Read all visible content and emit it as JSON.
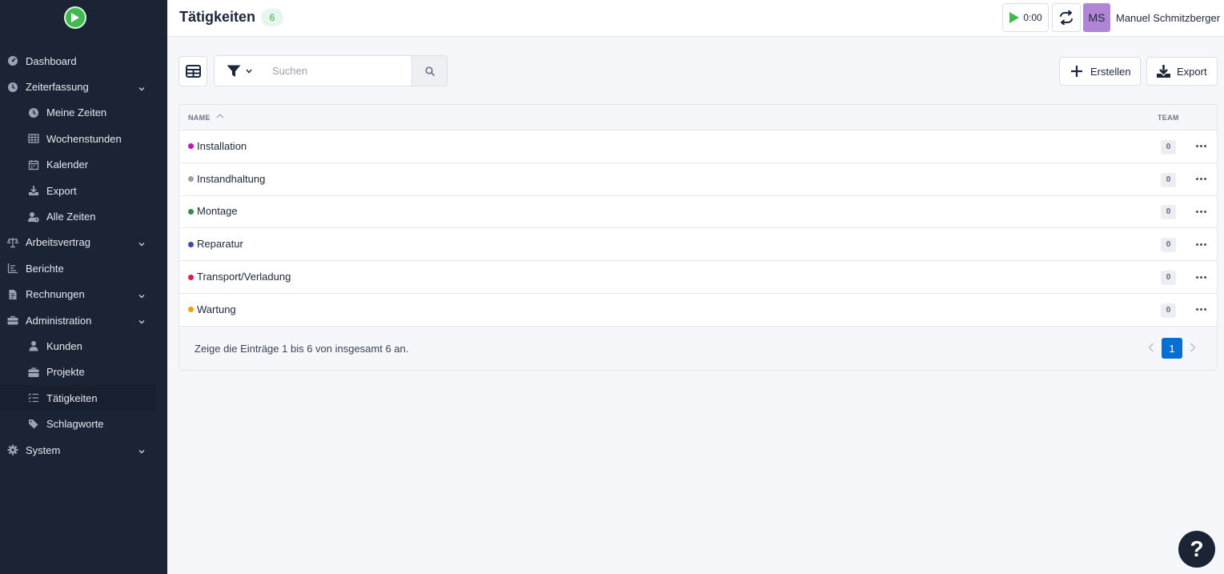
{
  "header": {
    "title": "Tätigkeiten",
    "count": "6",
    "timer": "0:00",
    "avatar_initials": "MS",
    "user_name": "Manuel Schmitzberger"
  },
  "sidebar": {
    "items": [
      {
        "label": "Dashboard",
        "icon": "dashboard-icon"
      },
      {
        "label": "Zeiterfassung",
        "icon": "clock-icon",
        "expandable": true
      },
      {
        "label": "Meine Zeiten",
        "icon": "clock-icon"
      },
      {
        "label": "Wochenstunden",
        "icon": "table-icon"
      },
      {
        "label": "Kalender",
        "icon": "calendar-icon"
      },
      {
        "label": "Export",
        "icon": "download-icon"
      },
      {
        "label": "Alle Zeiten",
        "icon": "user-clock-icon"
      },
      {
        "label": "Arbeitsvertrag",
        "icon": "scale-icon",
        "expandable": true
      },
      {
        "label": "Berichte",
        "icon": "chart-icon"
      },
      {
        "label": "Rechnungen",
        "icon": "invoice-icon",
        "expandable": true
      },
      {
        "label": "Administration",
        "icon": "toolbox-icon",
        "expandable": true
      },
      {
        "label": "Kunden",
        "icon": "user-icon"
      },
      {
        "label": "Projekte",
        "icon": "briefcase-icon"
      },
      {
        "label": "Tätigkeiten",
        "icon": "tasks-icon",
        "active": true
      },
      {
        "label": "Schlagworte",
        "icon": "tags-icon"
      },
      {
        "label": "System",
        "icon": "gear-icon",
        "expandable": true
      }
    ]
  },
  "toolbar": {
    "search_placeholder": "Suchen",
    "create_label": "Erstellen",
    "export_label": "Export"
  },
  "table": {
    "columns": {
      "name": "Name",
      "team": "Team"
    },
    "rows": [
      {
        "name": "Installation",
        "color": "#c014c0",
        "team": "0"
      },
      {
        "name": "Instandhaltung",
        "color": "#a0a0a0",
        "team": "0"
      },
      {
        "name": "Montage",
        "color": "#2f8a4e",
        "team": "0"
      },
      {
        "name": "Reparatur",
        "color": "#3a4aa8",
        "team": "0"
      },
      {
        "name": "Transport/Verladung",
        "color": "#e01c4f",
        "team": "0"
      },
      {
        "name": "Wartung",
        "color": "#f0a000",
        "team": "0"
      }
    ],
    "footer_text": "Zeige die Einträge 1 bis 6 von insgesamt 6 an.",
    "current_page": "1"
  },
  "help": {
    "label": "?"
  }
}
